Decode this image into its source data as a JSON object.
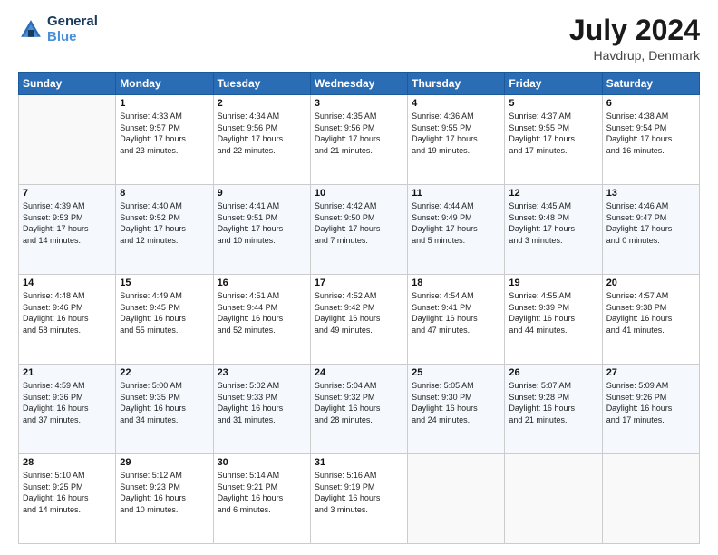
{
  "logo": {
    "line1": "General",
    "line2": "Blue"
  },
  "title": "July 2024",
  "subtitle": "Havdrup, Denmark",
  "header_days": [
    "Sunday",
    "Monday",
    "Tuesday",
    "Wednesday",
    "Thursday",
    "Friday",
    "Saturday"
  ],
  "weeks": [
    [
      {
        "num": "",
        "info": ""
      },
      {
        "num": "1",
        "info": "Sunrise: 4:33 AM\nSunset: 9:57 PM\nDaylight: 17 hours\nand 23 minutes."
      },
      {
        "num": "2",
        "info": "Sunrise: 4:34 AM\nSunset: 9:56 PM\nDaylight: 17 hours\nand 22 minutes."
      },
      {
        "num": "3",
        "info": "Sunrise: 4:35 AM\nSunset: 9:56 PM\nDaylight: 17 hours\nand 21 minutes."
      },
      {
        "num": "4",
        "info": "Sunrise: 4:36 AM\nSunset: 9:55 PM\nDaylight: 17 hours\nand 19 minutes."
      },
      {
        "num": "5",
        "info": "Sunrise: 4:37 AM\nSunset: 9:55 PM\nDaylight: 17 hours\nand 17 minutes."
      },
      {
        "num": "6",
        "info": "Sunrise: 4:38 AM\nSunset: 9:54 PM\nDaylight: 17 hours\nand 16 minutes."
      }
    ],
    [
      {
        "num": "7",
        "info": "Sunrise: 4:39 AM\nSunset: 9:53 PM\nDaylight: 17 hours\nand 14 minutes."
      },
      {
        "num": "8",
        "info": "Sunrise: 4:40 AM\nSunset: 9:52 PM\nDaylight: 17 hours\nand 12 minutes."
      },
      {
        "num": "9",
        "info": "Sunrise: 4:41 AM\nSunset: 9:51 PM\nDaylight: 17 hours\nand 10 minutes."
      },
      {
        "num": "10",
        "info": "Sunrise: 4:42 AM\nSunset: 9:50 PM\nDaylight: 17 hours\nand 7 minutes."
      },
      {
        "num": "11",
        "info": "Sunrise: 4:44 AM\nSunset: 9:49 PM\nDaylight: 17 hours\nand 5 minutes."
      },
      {
        "num": "12",
        "info": "Sunrise: 4:45 AM\nSunset: 9:48 PM\nDaylight: 17 hours\nand 3 minutes."
      },
      {
        "num": "13",
        "info": "Sunrise: 4:46 AM\nSunset: 9:47 PM\nDaylight: 17 hours\nand 0 minutes."
      }
    ],
    [
      {
        "num": "14",
        "info": "Sunrise: 4:48 AM\nSunset: 9:46 PM\nDaylight: 16 hours\nand 58 minutes."
      },
      {
        "num": "15",
        "info": "Sunrise: 4:49 AM\nSunset: 9:45 PM\nDaylight: 16 hours\nand 55 minutes."
      },
      {
        "num": "16",
        "info": "Sunrise: 4:51 AM\nSunset: 9:44 PM\nDaylight: 16 hours\nand 52 minutes."
      },
      {
        "num": "17",
        "info": "Sunrise: 4:52 AM\nSunset: 9:42 PM\nDaylight: 16 hours\nand 49 minutes."
      },
      {
        "num": "18",
        "info": "Sunrise: 4:54 AM\nSunset: 9:41 PM\nDaylight: 16 hours\nand 47 minutes."
      },
      {
        "num": "19",
        "info": "Sunrise: 4:55 AM\nSunset: 9:39 PM\nDaylight: 16 hours\nand 44 minutes."
      },
      {
        "num": "20",
        "info": "Sunrise: 4:57 AM\nSunset: 9:38 PM\nDaylight: 16 hours\nand 41 minutes."
      }
    ],
    [
      {
        "num": "21",
        "info": "Sunrise: 4:59 AM\nSunset: 9:36 PM\nDaylight: 16 hours\nand 37 minutes."
      },
      {
        "num": "22",
        "info": "Sunrise: 5:00 AM\nSunset: 9:35 PM\nDaylight: 16 hours\nand 34 minutes."
      },
      {
        "num": "23",
        "info": "Sunrise: 5:02 AM\nSunset: 9:33 PM\nDaylight: 16 hours\nand 31 minutes."
      },
      {
        "num": "24",
        "info": "Sunrise: 5:04 AM\nSunset: 9:32 PM\nDaylight: 16 hours\nand 28 minutes."
      },
      {
        "num": "25",
        "info": "Sunrise: 5:05 AM\nSunset: 9:30 PM\nDaylight: 16 hours\nand 24 minutes."
      },
      {
        "num": "26",
        "info": "Sunrise: 5:07 AM\nSunset: 9:28 PM\nDaylight: 16 hours\nand 21 minutes."
      },
      {
        "num": "27",
        "info": "Sunrise: 5:09 AM\nSunset: 9:26 PM\nDaylight: 16 hours\nand 17 minutes."
      }
    ],
    [
      {
        "num": "28",
        "info": "Sunrise: 5:10 AM\nSunset: 9:25 PM\nDaylight: 16 hours\nand 14 minutes."
      },
      {
        "num": "29",
        "info": "Sunrise: 5:12 AM\nSunset: 9:23 PM\nDaylight: 16 hours\nand 10 minutes."
      },
      {
        "num": "30",
        "info": "Sunrise: 5:14 AM\nSunset: 9:21 PM\nDaylight: 16 hours\nand 6 minutes."
      },
      {
        "num": "31",
        "info": "Sunrise: 5:16 AM\nSunset: 9:19 PM\nDaylight: 16 hours\nand 3 minutes."
      },
      {
        "num": "",
        "info": ""
      },
      {
        "num": "",
        "info": ""
      },
      {
        "num": "",
        "info": ""
      }
    ]
  ]
}
